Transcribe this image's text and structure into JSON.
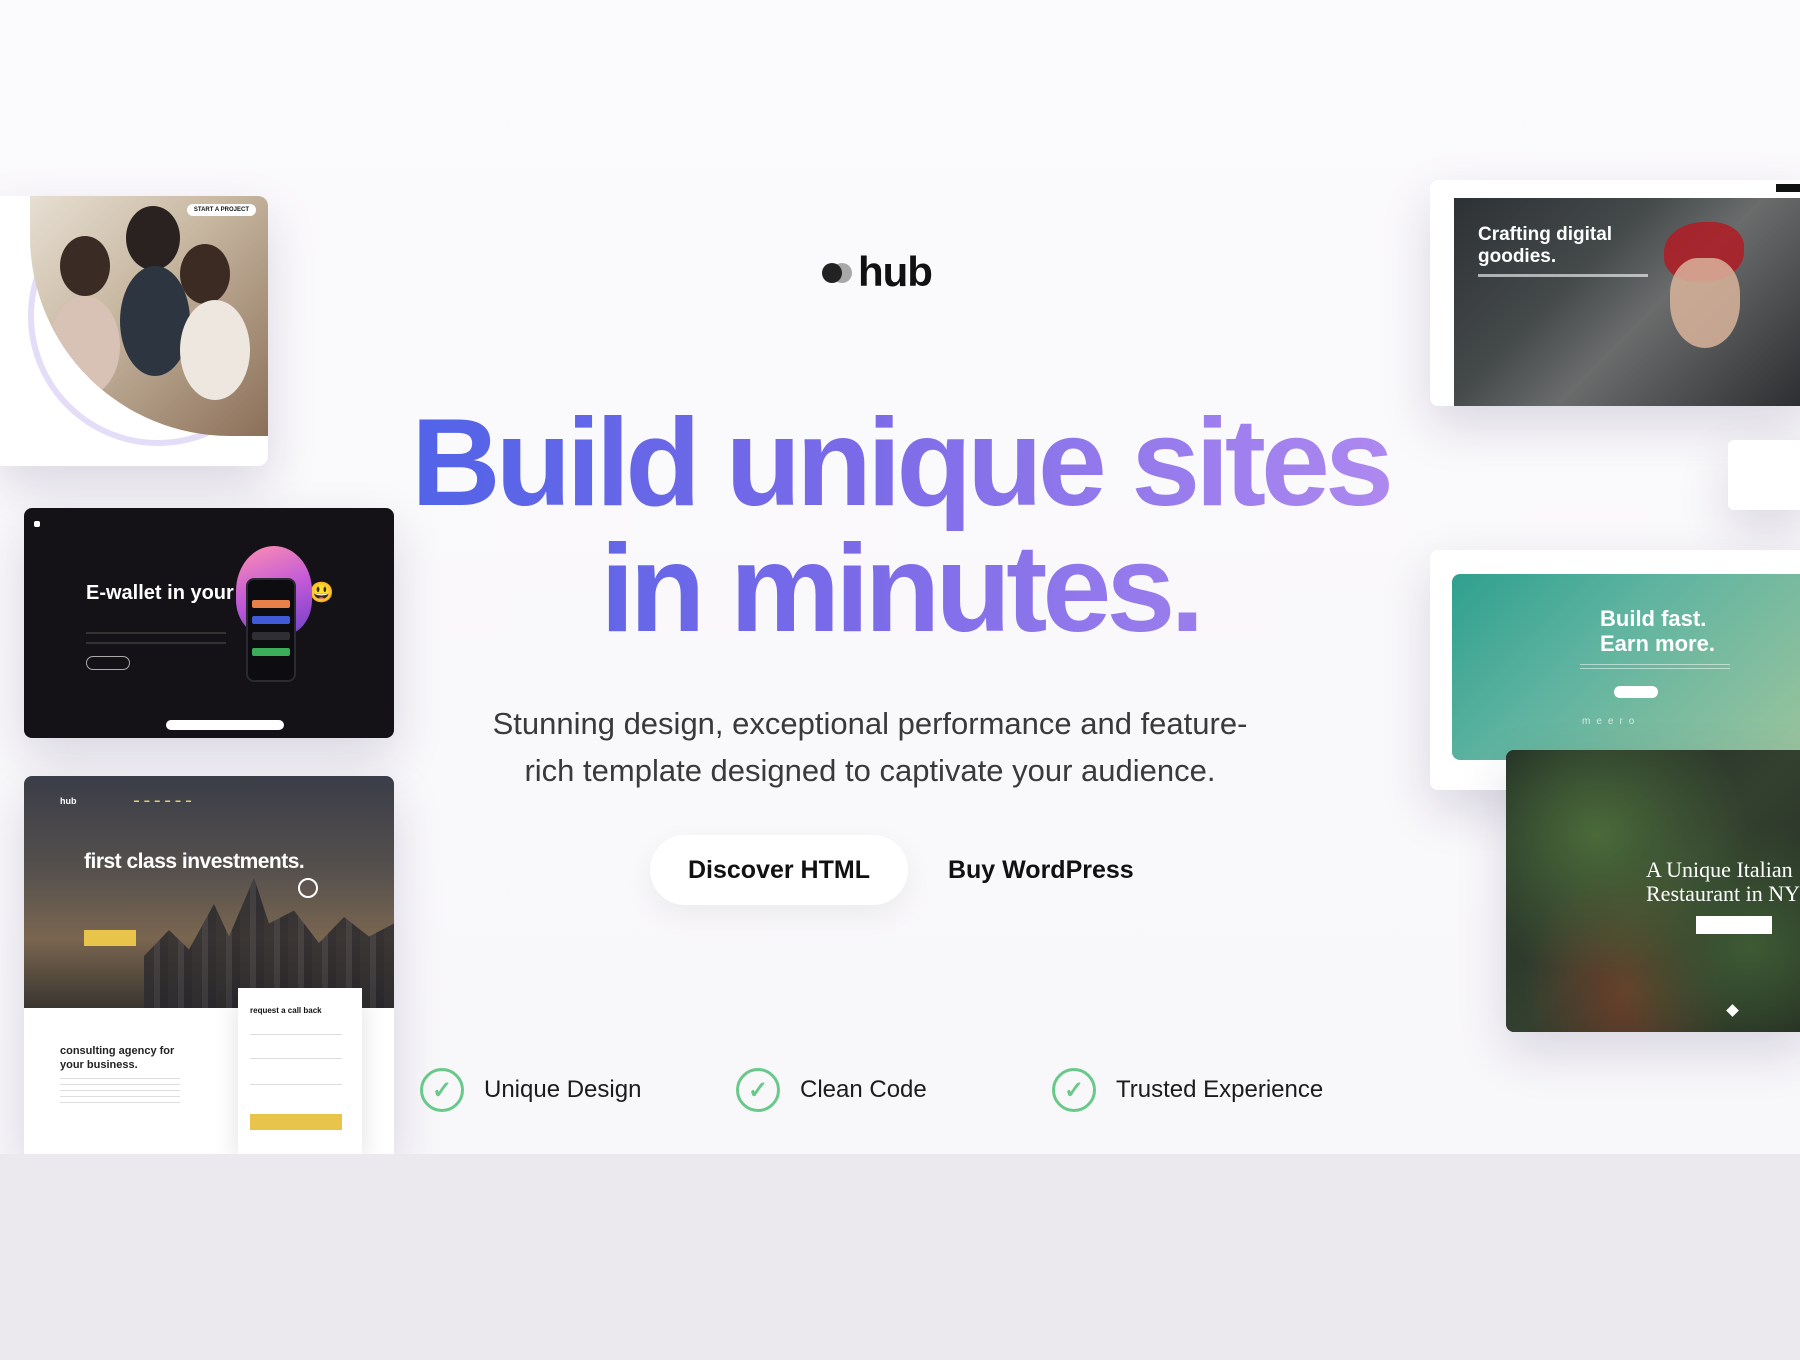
{
  "brand": {
    "name": "hub"
  },
  "hero": {
    "headline_line1": "Build unique sites",
    "headline_line2": "in minutes.",
    "subtitle": "Stunning design, exceptional performance and feature-rich template designed to captivate your audience.",
    "gradient_colors": [
      "#4f63e8",
      "#7a6ae8",
      "#b08af0"
    ]
  },
  "actions": {
    "primary_label": "Discover HTML",
    "secondary_label": "Buy WordPress"
  },
  "features": [
    {
      "label": "Unique Design",
      "icon": "check-circle-icon"
    },
    {
      "label": "Clean Code",
      "icon": "check-circle-icon"
    },
    {
      "label": "Trusted Experience",
      "icon": "check-circle-icon"
    }
  ],
  "previews": {
    "team": {
      "cta": "START A PROJECT"
    },
    "wallet": {
      "title": "E-wallet in your pocket 😃"
    },
    "invest": {
      "logo": "hub",
      "title": "first class investments.",
      "form_title": "request a call back",
      "about_title": "consulting agency for your business."
    },
    "craft": {
      "title": "Crafting digital goodies."
    },
    "build": {
      "title": "Build fast. Earn more.",
      "logos": "meero"
    },
    "restaurant": {
      "title": "A Unique Italian Restaurant in NY"
    }
  },
  "colors": {
    "check": "#69c98b",
    "background": "#fbfafc"
  }
}
